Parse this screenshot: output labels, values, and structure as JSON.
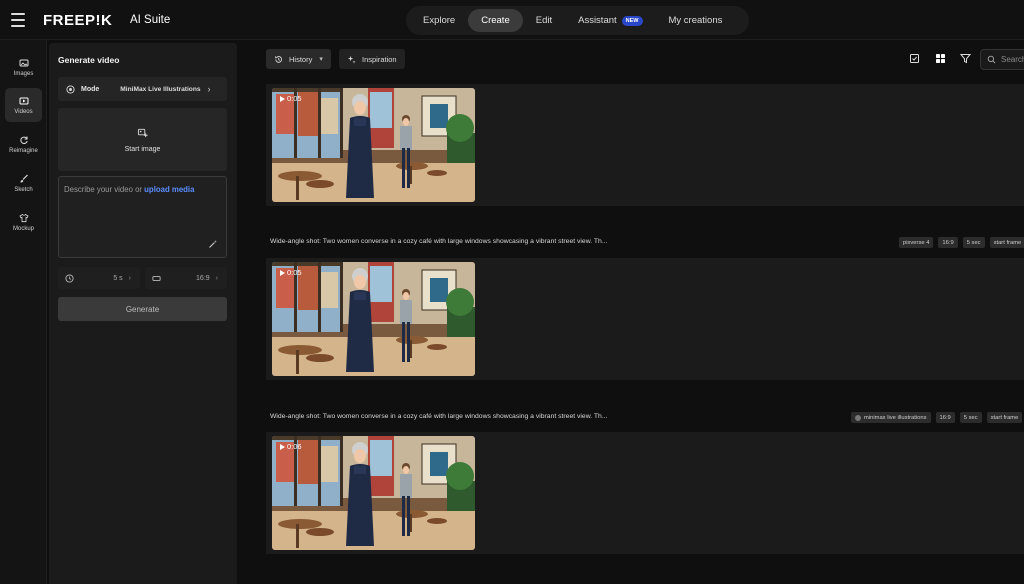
{
  "app": {
    "logo": "FREEP!K",
    "suite": "AI Suite"
  },
  "nav": {
    "items": [
      "Explore",
      "Create",
      "Edit",
      "Assistant",
      "My creations"
    ],
    "active": "Create",
    "assistant_badge": "NEW"
  },
  "rail": {
    "items": [
      {
        "label": "Images",
        "icon": "image-icon"
      },
      {
        "label": "Videos",
        "icon": "video-icon"
      },
      {
        "label": "Reimagine",
        "icon": "reimagine-icon"
      },
      {
        "label": "Sketch",
        "icon": "brush-icon"
      },
      {
        "label": "Mockup",
        "icon": "shirt-icon"
      }
    ],
    "active": "Videos"
  },
  "panel": {
    "title": "Generate video",
    "mode_label": "Mode",
    "mode_value": "MiniMax Live Illustrations",
    "start_image": "Start image",
    "prompt_placeholder": "Describe your video or ",
    "prompt_link": "upload media",
    "duration": "5 s",
    "aspect": "16:9",
    "generate": "Generate"
  },
  "toolbar": {
    "history": "History",
    "inspiration": "Inspiration",
    "search_placeholder": "Search"
  },
  "results": [
    {
      "duration": "0:05",
      "prompt": "",
      "tags": []
    },
    {
      "duration": "0:05",
      "prompt": "Wide-angle shot: Two women converse in a cozy café with large windows showcasing a vibrant street view. Th...",
      "tags": [
        "pixverse 4",
        "16:9",
        "5 sec",
        "start frame"
      ]
    },
    {
      "duration": "0:06",
      "prompt": "Wide-angle shot: Two women converse in a cozy café with large windows showcasing a vibrant street view. Th...",
      "tags": [
        "minimax live illustrations",
        "16:9",
        "5 sec",
        "start frame"
      ]
    }
  ],
  "colors": {
    "background": "#0f0f0f",
    "panel": "#1b1b1b",
    "accent_link": "#5a8dff",
    "badge": "#2a47c9"
  }
}
